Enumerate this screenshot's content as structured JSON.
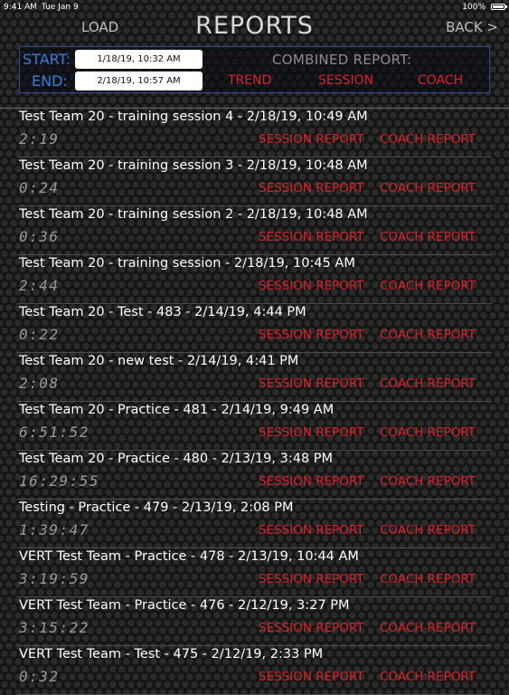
{
  "status_bar": {
    "time": "9:41 AM",
    "date": "Tue Jan 9",
    "battery": "100%"
  },
  "nav": {
    "load_label": "LOAD",
    "title": "REPORTS",
    "back_label": "BACK >"
  },
  "filters": {
    "start_label": "START:",
    "start_value": "1/18/19, 10:32 AM",
    "end_label": "END:",
    "end_value": "2/18/19, 10:57 AM",
    "combined_label": "COMBINED REPORT:",
    "trend_label": "TREND",
    "session_label": "SESSION",
    "coach_label": "COACH"
  },
  "colors": {
    "accent_red": "#d8232a",
    "accent_blue": "#3d7bdb"
  },
  "reports": [
    {
      "title": "Test Team 20 - training session 4 - 2/18/19, 10:49 AM",
      "duration": "2:19",
      "session_link": "SESSION REPORT",
      "coach_link": "COACH REPORT"
    },
    {
      "title": "Test Team 20 - training session 3 - 2/18/19, 10:48 AM",
      "duration": "0:24",
      "session_link": "SESSION REPORT",
      "coach_link": "COACH REPORT"
    },
    {
      "title": "Test Team 20 - training session 2 - 2/18/19, 10:48 AM",
      "duration": "0:36",
      "session_link": "SESSION REPORT",
      "coach_link": "COACH REPORT"
    },
    {
      "title": "Test Team 20 - training session - 2/18/19, 10:45 AM",
      "duration": "2:44",
      "session_link": "SESSION REPORT",
      "coach_link": "COACH REPORT"
    },
    {
      "title": "Test Team 20 - Test - 483 - 2/14/19, 4:44 PM",
      "duration": "0:22",
      "session_link": "SESSION REPORT",
      "coach_link": "COACH REPORT"
    },
    {
      "title": "Test Team 20 - new test  - 2/14/19, 4:41 PM",
      "duration": "2:08",
      "session_link": "SESSION REPORT",
      "coach_link": "COACH REPORT"
    },
    {
      "title": "Test Team 20 - Practice - 481 - 2/14/19, 9:49 AM",
      "duration": "6:51:52",
      "session_link": "SESSION REPORT",
      "coach_link": "COACH REPORT"
    },
    {
      "title": "Test Team 20 - Practice - 480 - 2/13/19, 3:48 PM",
      "duration": "16:29:55",
      "session_link": "SESSION REPORT",
      "coach_link": "COACH REPORT"
    },
    {
      "title": "Testing - Practice - 479 - 2/13/19, 2:08 PM",
      "duration": "1:39:47",
      "session_link": "SESSION REPORT",
      "coach_link": "COACH REPORT"
    },
    {
      "title": "VERT Test Team  - Practice - 478 - 2/13/19, 10:44 AM",
      "duration": "3:19:59",
      "session_link": "SESSION REPORT",
      "coach_link": "COACH REPORT"
    },
    {
      "title": "VERT Test Team  - Practice - 476 - 2/12/19, 3:27 PM",
      "duration": "3:15:22",
      "session_link": "SESSION REPORT",
      "coach_link": "COACH REPORT"
    },
    {
      "title": "VERT Test Team  - Test - 475 - 2/12/19, 2:33 PM",
      "duration": "0:32",
      "session_link": "SESSION REPORT",
      "coach_link": "COACH REPORT"
    }
  ]
}
